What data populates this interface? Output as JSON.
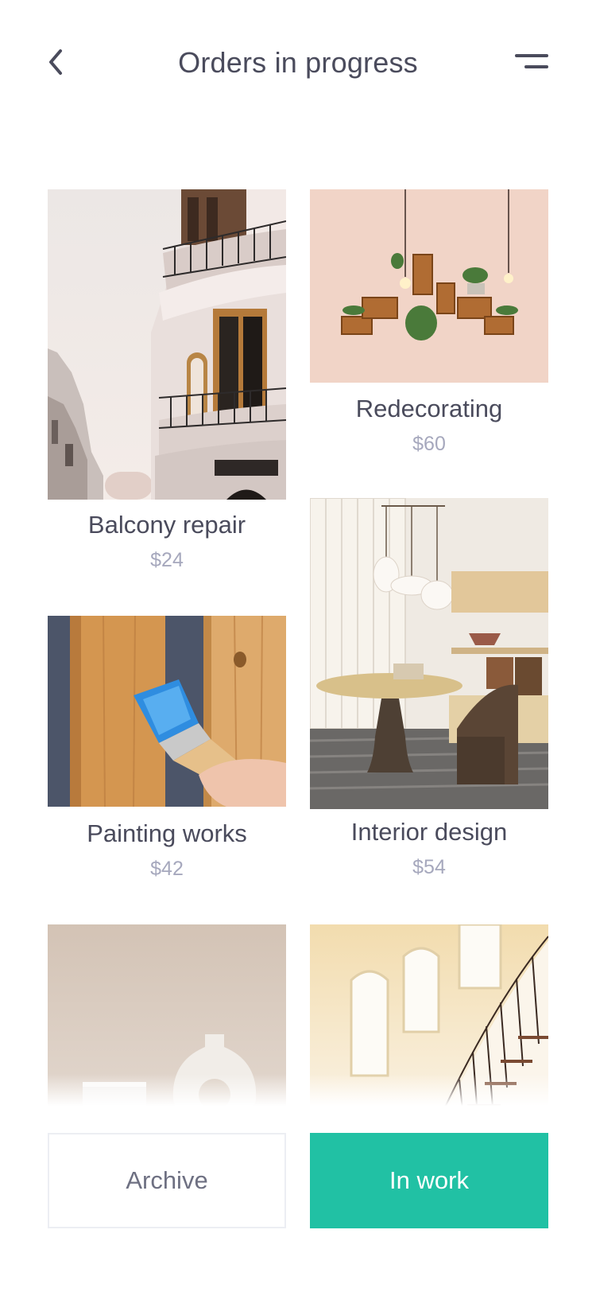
{
  "header": {
    "title": "Orders in progress",
    "back_icon": "chevron-left-icon",
    "menu_icon": "menu-icon"
  },
  "orders": [
    {
      "name": "Balcony repair",
      "price": "$24",
      "image": "balcony-photo"
    },
    {
      "name": "Redecorating",
      "price": "$60",
      "image": "wall-shelves-photo"
    },
    {
      "name": "Painting works",
      "price": "$42",
      "image": "paint-brush-photo"
    },
    {
      "name": "Interior design",
      "price": "$54",
      "image": "dining-room-photo"
    },
    {
      "image": "vase-photo"
    },
    {
      "image": "staircase-photo"
    }
  ],
  "tabs": {
    "archive_label": "Archive",
    "in_work_label": "In work"
  },
  "colors": {
    "accent": "#21c1a4",
    "text": "#4a4b5c",
    "price": "#a6a8bd"
  }
}
